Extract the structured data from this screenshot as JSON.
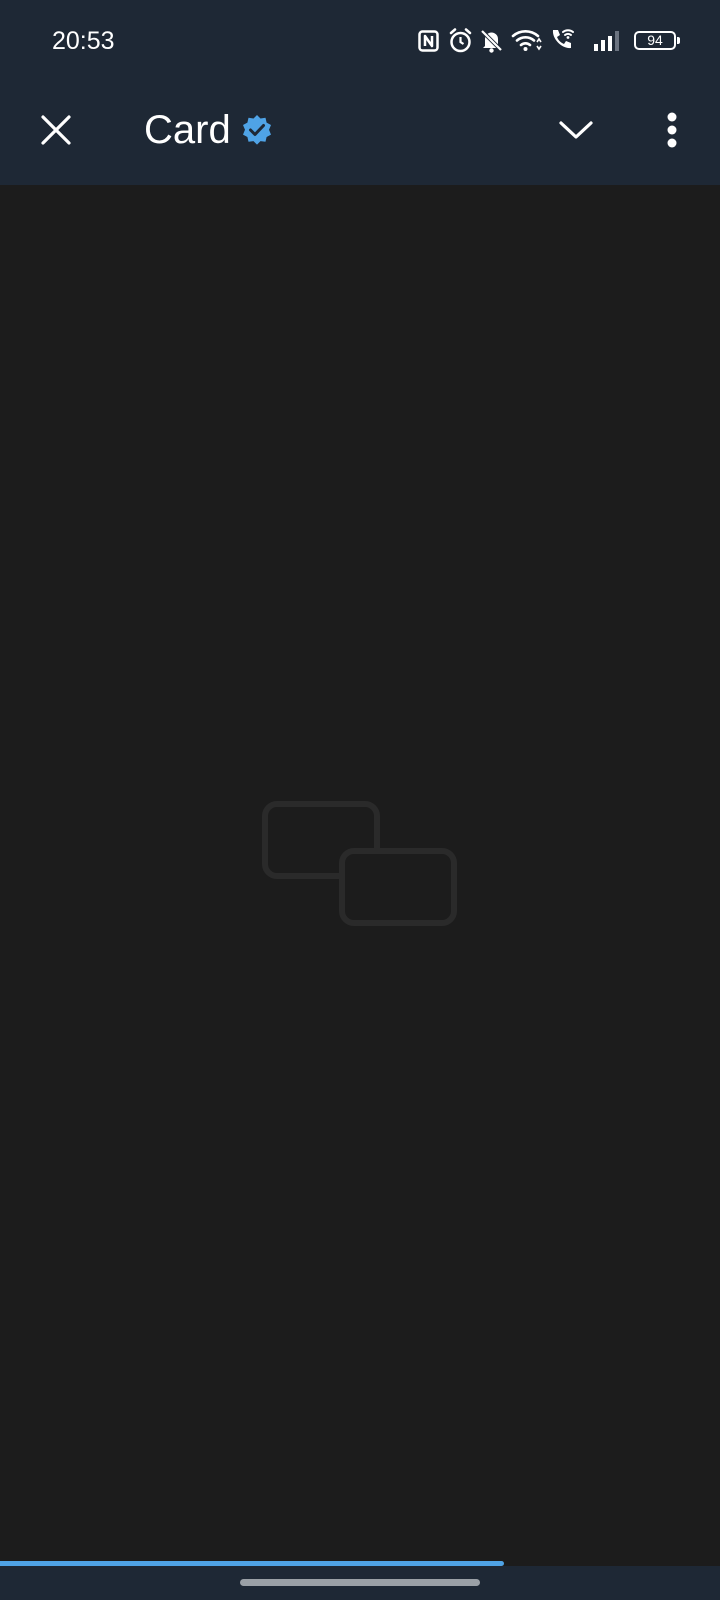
{
  "status_bar": {
    "time": "20:53",
    "battery": "94",
    "icons": [
      "nfc-icon",
      "alarm-icon",
      "bell-off-icon",
      "wifi-icon",
      "wifi-calling-icon",
      "signal-icon",
      "battery-icon"
    ]
  },
  "app_bar": {
    "title": "Card",
    "icons": [
      "close-icon",
      "verified-badge-icon",
      "chevron-down-icon",
      "more-vert-icon"
    ]
  },
  "content": {
    "placeholder_icon": "image-placeholder-icon"
  },
  "loading_progress": 0.7,
  "colors": {
    "bar_background": "#1e2835",
    "content_background": "#1c1c1c",
    "accent": "#4fa3e6",
    "placeholder": "#2a2a2a"
  }
}
